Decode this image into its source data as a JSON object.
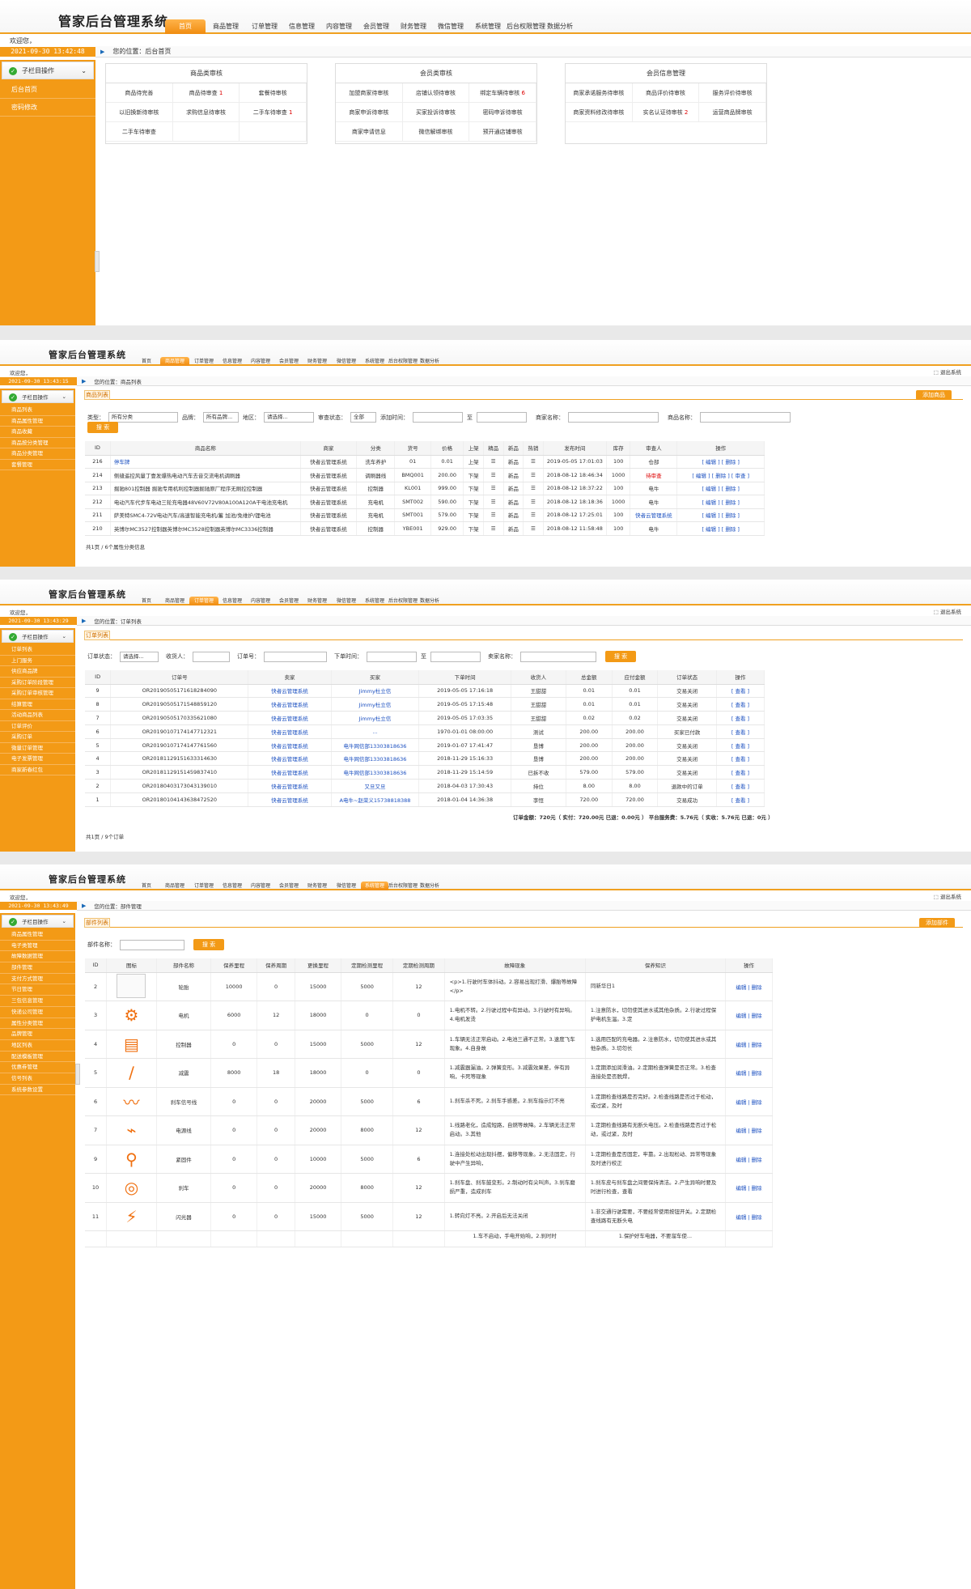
{
  "app": {
    "title": "管家后台管理系统",
    "logout": "退出系统",
    "welcome": "欢迎您，"
  },
  "nav": [
    "首页",
    "商品管理",
    "订单管理",
    "信息管理",
    "内容管理",
    "会员管理",
    "财务管理",
    "微信管理",
    "系统管理",
    "后台权限管理",
    "数据分析"
  ],
  "colors": {
    "accent": "#f39a16",
    "link": "#1a4fc0",
    "alert": "#dd0000"
  },
  "panel1": {
    "time": "2021-09-30 13:42:48",
    "breadcrumb": "您的位置：后台首页",
    "side_title": "子栏目操作",
    "side_items": [
      "后台首页",
      "密码修改"
    ],
    "cards": [
      {
        "title": "商品类审核",
        "items": [
          {
            "label": "商品待完善",
            "n": ""
          },
          {
            "label": "商品待审查",
            "n": "1"
          },
          {
            "label": "套餐待审核",
            "n": ""
          },
          {
            "label": "以旧换新待审核",
            "n": ""
          },
          {
            "label": "求购信息待审核",
            "n": ""
          },
          {
            "label": "二手车待审查",
            "n": "1"
          },
          {
            "label": "二手车待审查",
            "n": ""
          }
        ]
      },
      {
        "title": "会员类审核",
        "items": [
          {
            "label": "加盟商家待审核",
            "n": ""
          },
          {
            "label": "店铺认领待审核",
            "n": ""
          },
          {
            "label": "绑定车辆待审核",
            "n": "6"
          },
          {
            "label": "商家申诉待审核",
            "n": ""
          },
          {
            "label": "买家投诉待审核",
            "n": ""
          },
          {
            "label": "密码申诉待审核",
            "n": ""
          },
          {
            "label": "商家申请信息",
            "n": ""
          },
          {
            "label": "微信解绑审核",
            "n": ""
          },
          {
            "label": "预开通店铺审核",
            "n": ""
          }
        ]
      },
      {
        "title": "会员信息管理",
        "items": [
          {
            "label": "商家承诺服务待审核",
            "n": ""
          },
          {
            "label": "商品评价待审核",
            "n": ""
          },
          {
            "label": "服务评价待审核",
            "n": ""
          },
          {
            "label": "商家资料修改待审核",
            "n": ""
          },
          {
            "label": "实名认证待审核",
            "n": "2"
          },
          {
            "label": "运营商品牌审核",
            "n": ""
          }
        ]
      }
    ]
  },
  "panel2": {
    "time": "2021-09-30 13:43:15",
    "breadcrumb": "您的位置：商品列表",
    "tab": "商品列表",
    "add": "添加商品",
    "side_title": "子栏目操作",
    "side_items": [
      "商品列表",
      "商品属性管理",
      "商品收藏",
      "商品按分类管理",
      "商品分类管理",
      "套餐管理"
    ],
    "filters": {
      "type_label": "类型：",
      "type_value": "所有分类",
      "brand_label": "品牌：",
      "brand_value": "所有品牌...",
      "region_label": "地区：",
      "region_value": "请选择...",
      "status_label": "审查状态：",
      "status_value": "全部",
      "time_label": "添加时间：",
      "to": "至",
      "seller_label": "商家名称：",
      "name_label": "商品名称：",
      "search": "搜 索"
    },
    "headers": [
      "ID",
      "商品名称",
      "商家",
      "分类",
      "货号",
      "价格",
      "上架",
      "精品",
      "新品",
      "热销",
      "发布时间",
      "库存",
      "审查人",
      "操作"
    ],
    "rows": [
      [
        "216",
        "停车牌",
        "快者云管理系统",
        "洗车养护",
        "01",
        "0.01",
        "上架",
        "☰",
        "新品",
        "☰",
        "2019-05-05 17:01:03",
        "100",
        "仓部",
        "[ 编辑 ] [ 删除 ]"
      ],
      [
        "214",
        "侧缝遥控风量丁壹发爆热电动汽车去音交流电机调刷器",
        "快者云管理系统",
        "调刷器线",
        "BMQ001",
        "200.00",
        "下架",
        "☰",
        "新品",
        "☰",
        "2018-08-12 18:46:34",
        "1000",
        "待审查",
        "[ 编辑 ] [ 删除 ] [ 审查 ]"
      ],
      [
        "213",
        "掘驰801控制器 掘驰专用机利控制器掘驰原厂程序无刷控控制器",
        "快者云管理系统",
        "控制器",
        "KL001",
        "999.00",
        "下架",
        "☰",
        "新品",
        "☰",
        "2018-08-12 18:37:22",
        "100",
        "电牛",
        "[ 编辑 ] [ 删除 ]"
      ],
      [
        "212",
        "电动汽车代步车电动三轮充电器48V60V72V80A100A120A干电池充电机",
        "快者云管理系统",
        "充电机",
        "SMT002",
        "590.00",
        "下架",
        "☰",
        "新品",
        "☰",
        "2018-08-12 18:18:36",
        "1000",
        "电牛",
        "[ 编辑 ] [ 删除 ]"
      ],
      [
        "211",
        "萨美特SMC4-72V电动汽车/高速智能充电机/蓄 加池/免维护/锂电池",
        "快者云管理系统",
        "充电机",
        "SMT001",
        "579.00",
        "下架",
        "☰",
        "新品",
        "☰",
        "2018-08-12 17:25:01",
        "100",
        "快者云管理系统",
        "[ 编辑 ] [ 删除 ]"
      ],
      [
        "210",
        "英博尔MC3527控制器英博尔MC3528控制器英博尔MC3336控制器",
        "快者云管理系统",
        "控制器",
        "YBE001",
        "929.00",
        "下架",
        "☰",
        "新品",
        "☰",
        "2018-08-12 11:58:48",
        "100",
        "电牛",
        "[ 编辑 ] [ 删除 ]"
      ]
    ],
    "footer": "共1页 / 6个属性分类信息"
  },
  "panel3": {
    "time": "2021-09-30 13:43:29",
    "breadcrumb": "您的位置：订单列表",
    "tab": "订单列表",
    "side_title": "子栏目操作",
    "side_items": [
      "订单列表",
      "上门服务",
      "供应商品牌",
      "采购订单阶段管理",
      "采购订单审核管理",
      "结算管理",
      "活动商品列表",
      "订单评价",
      "采购订单",
      "微量订单管理",
      "电子发票管理",
      "商家新春红包"
    ],
    "filters": {
      "status_label": "订单状态：",
      "status_value": "请选择...",
      "receiver_label": "收货人：",
      "order_label": "订单号：",
      "time_label": "下单时间：",
      "to": "至",
      "buyer_label": "卖家名称：",
      "search": "搜 索"
    },
    "headers": [
      "ID",
      "订单号",
      "卖家",
      "买家",
      "下单时间",
      "收货人",
      "总金额",
      "应付金额",
      "订单状态",
      "操作"
    ],
    "rows": [
      [
        "9",
        "OR20190505171618284090",
        "快者云管理系统",
        "Jimmy杜立信",
        "2019-05-05 17:16:18",
        "王甜甜",
        "0.01",
        "0.01",
        "交易关闭",
        "[ 查看 ]"
      ],
      [
        "8",
        "OR20190505171548859120",
        "快者云管理系统",
        "Jimmy杜立信",
        "2019-05-05 17:15:48",
        "王甜甜",
        "0.01",
        "0.01",
        "交易关闭",
        "[ 查看 ]"
      ],
      [
        "7",
        "OR20190505170335621080",
        "快者云管理系统",
        "Jimmy杜立信",
        "2019-05-05 17:03:35",
        "王甜甜",
        "0.02",
        "0.02",
        "交易关闭",
        "[ 查看 ]"
      ],
      [
        "6",
        "OR20190107174147712321",
        "快者云管理系统",
        "...",
        "1970-01-01 08:00:00",
        "测试",
        "200.00",
        "200.00",
        "买家已付款",
        "[ 查看 ]"
      ],
      [
        "5",
        "OR20190107174147761560",
        "快者云管理系统",
        "电牛网信部13303818636",
        "2019-01-07 17:41:47",
        "垦博",
        "200.00",
        "200.00",
        "交易关闭",
        "[ 查看 ]"
      ],
      [
        "4",
        "OR20181129151633314630",
        "快者云管理系统",
        "电牛网信部13303818636",
        "2018-11-29 15:16:33",
        "垦博",
        "200.00",
        "200.00",
        "交易关闭",
        "[ 查看 ]"
      ],
      [
        "3",
        "OR20181129151459837410",
        "快者云管理系统",
        "电牛网信部13303818636",
        "2018-11-29 15:14:59",
        "已拆不收",
        "579.00",
        "579.00",
        "交易关闭",
        "[ 查看 ]"
      ],
      [
        "2",
        "OR20180403173043139010",
        "快者云管理系统",
        "又旦又旦",
        "2018-04-03 17:30:43",
        "持位",
        "8.00",
        "8.00",
        "退款中的订单",
        "[ 查看 ]"
      ],
      [
        "1",
        "OR20180104143638472520",
        "快者云管理系统",
        "A电牛~赵荣义15738818388",
        "2018-01-04 14:36:38",
        "李恒",
        "720.00",
        "720.00",
        "交易成功",
        "[ 查看 ]"
      ]
    ],
    "total": "订单金额：720元（ 实付：720.00元   已退：0.00元 ）   平台服务费：5.76元（ 实收：5.76元   已退：0元 ）",
    "footer": "共1页 / 9个订单"
  },
  "panel4": {
    "time": "2021-09-30 13:43:49",
    "breadcrumb": "您的位置：部件管理",
    "tab": "部件列表",
    "add": "添加部件",
    "side_title": "子栏目操作",
    "side_items": [
      "商品属性管理",
      "电子类管理",
      "故障数据管理",
      "部件管理",
      "支付方式管理",
      "节日管理",
      "三包信息管理",
      "快递公司管理",
      "属性分类管理",
      "品牌管理",
      "地区列表",
      "配送模板管理",
      "优惠券管理",
      "信号列表",
      "系统参数设置"
    ],
    "filters": {
      "name_label": "部件名称：",
      "search": "搜 索"
    },
    "headers": [
      "ID",
      "图标",
      "部件名称",
      "保养里程",
      "保养周期",
      "更换里程",
      "定期检测里程",
      "定期检测周期",
      "故障现象",
      "保养知识",
      "操作"
    ],
    "rows": [
      {
        "id": "2",
        "icon": "blank",
        "name": "轮胎",
        "a": "10000",
        "b": "0",
        "c": "15000",
        "d": "5000",
        "e": "12",
        "f": "<p>1.行驶时车体抖动。2.容易出现打滑、爆胎等故障</p>",
        "g": "同新华日1",
        "op": "编辑 | 删除"
      },
      {
        "id": "3",
        "icon": "motor-icon",
        "name": "电机",
        "a": "6000",
        "b": "12",
        "c": "18000",
        "d": "0",
        "e": "0",
        "f": "1.电机不转。2.行驶过程中有异动。3.行驶时有异响。4.电机发烫",
        "g": "1.注意防水，切勿使其进水或其他杂质。2.行驶过程保护电机生温。3.定",
        "op": "编辑 | 删除"
      },
      {
        "id": "4",
        "icon": "controller-icon",
        "name": "控制器",
        "a": "0",
        "b": "0",
        "c": "15000",
        "d": "5000",
        "e": "12",
        "f": "1.车辆无法正常启动。2.电池三通不正常。3.速度飞车现象。4.自身故",
        "g": "1.选用匹配的充电器。2.注意防水，切勿使其进水或其他杂质。3.切勿长",
        "op": "编辑 | 删除"
      },
      {
        "id": "5",
        "icon": "shock-icon",
        "name": "减震",
        "a": "8000",
        "b": "18",
        "c": "18000",
        "d": "0",
        "e": "0",
        "f": "1.减震器漏油。2.弹簧变形。3.减震效果差，伴有异响，卡死等现象",
        "g": "1.定期添加润滑油。2.定期检查弹簧是否正常。3.检查连接处是否脱焊，",
        "op": "编辑 | 删除"
      },
      {
        "id": "6",
        "icon": "brake-cable-icon",
        "name": "刹车信号线",
        "a": "0",
        "b": "0",
        "c": "20000",
        "d": "5000",
        "e": "6",
        "f": "1.刹车杀不死。2.刹车手感差。2.刹车指示灯不亮",
        "g": "1.定期检查线路是否完好。2.检查线路是否过于松动，或过紧，及时",
        "op": "编辑 | 删除"
      },
      {
        "id": "7",
        "icon": "power-cable-icon",
        "name": "电源线",
        "a": "0",
        "b": "0",
        "c": "20000",
        "d": "8000",
        "e": "12",
        "f": "1.线路老化，造成短路，自燃等故障。2.车辆无法正常启动。3.其他",
        "g": "1.定期检查线路有无断头电压。2.检查线路是否过于松动，或过紧，及时",
        "op": "编辑 | 删除"
      },
      {
        "id": "9",
        "icon": "fastener-icon",
        "name": "紧固件",
        "a": "0",
        "b": "0",
        "c": "10000",
        "d": "5000",
        "e": "6",
        "f": "1.连接处松动出现抖摆，偏移等现象。2.无法固定，行驶中产生异响，",
        "g": "1.定期检查是否固定，牢靠。2.出现松动、异常等现象及时进行校正",
        "op": "编辑 | 删除"
      },
      {
        "id": "10",
        "icon": "brake-disc-icon",
        "name": "刹车",
        "a": "0",
        "b": "0",
        "c": "20000",
        "d": "8000",
        "e": "12",
        "f": "1.刹车盘、刹车鼓变形。2.制动时有尖叫声。3.刹车磨损严重，造成刹车",
        "g": "1.刹车皮与刹车盘之间要保持清洁。2.产生异响时要及时进行检查，查看",
        "op": "编辑 | 删除"
      },
      {
        "id": "11",
        "icon": "headlight-icon",
        "name": "闪光器",
        "a": "0",
        "b": "0",
        "c": "15000",
        "d": "5000",
        "e": "12",
        "f": "1.转向灯不亮。2.开启后无法关闭",
        "g": "1.非交通行驶需要，不要经常使用按钮开关。2.定期检查线路有无断头电",
        "op": "编辑 | 删除"
      }
    ],
    "partial_row": {
      "f": "1.车不启动，手电开始响，2.刹时时",
      "g": "1.保护好车电器，不要溜车使..."
    }
  }
}
